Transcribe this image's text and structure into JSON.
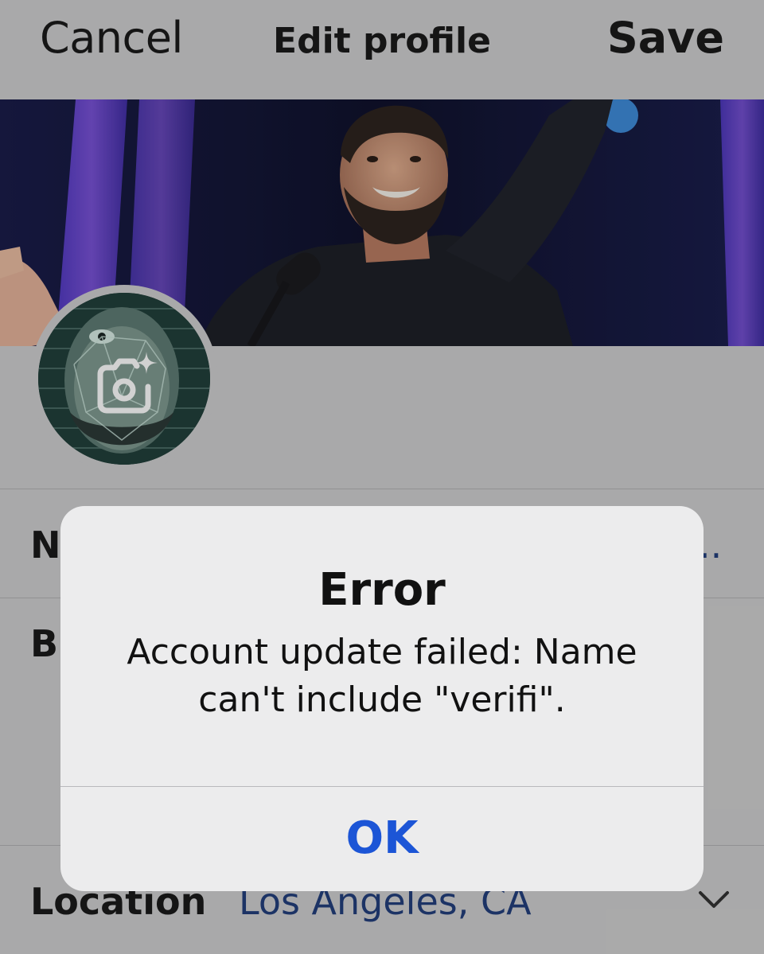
{
  "header": {
    "cancel_label": "Cancel",
    "title": "Edit profile",
    "save_label": "Save"
  },
  "form": {
    "name_label": "N",
    "name_value_ellipsis": "..",
    "bio_label": "Bi",
    "location_label": "Location",
    "location_value": "Los Angeles, CA"
  },
  "alert": {
    "title": "Error",
    "message": "Account update failed: Name can't include \"verifi\".",
    "ok_label": "OK"
  },
  "icons": {
    "avatar_camera": "camera-sparkle-icon",
    "location_chevron": "chevron-down-icon"
  },
  "colors": {
    "accent_link": "#1c55d6",
    "field_value": "#233f7c",
    "background": "#cfcfd0",
    "alert_background": "#ececed"
  }
}
